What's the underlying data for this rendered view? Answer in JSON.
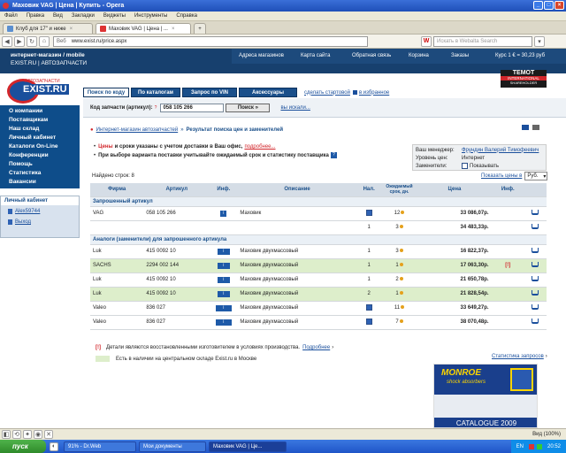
{
  "window": {
    "title": "Маховик VAG | Цена | Купить - Opera"
  },
  "menu": [
    "Файл",
    "Правка",
    "Вид",
    "Закладки",
    "Виджеты",
    "Инструменты",
    "Справка"
  ],
  "tabs": [
    {
      "label": "Клуб для 17\" и ниже"
    },
    {
      "label": "Маховик VAG | Цена | ..."
    }
  ],
  "address": {
    "prefix": "Веб",
    "url": "www.exist.ru/price.aspx",
    "search_placeholder": "Искать в Webalta Search"
  },
  "site": {
    "tagline1": "интернет-магазин / mobile",
    "tagline2": "EXIST.RU | АВТОЗАПЧАСТИ",
    "topnav": [
      "Адреса магазинов",
      "Карта сайта",
      "Обратная связь",
      "Корзина",
      "Заказы"
    ],
    "rate": "Курс 1 € = 30,23 руб",
    "logo_small": "АВТОЗАПЧАСТИ",
    "logo_text": "EXIST.RU",
    "temot_1": "TEMOT",
    "temot_2": "INTERNATIONAL",
    "temot_3": "SHAREHOLDER",
    "search_tabs": [
      "Поиск по коду",
      "По каталогам",
      "Запрос по VIN",
      "Аксессуары"
    ],
    "link_start": "сделать стартовой",
    "link_fav": "в избранное",
    "search_label": "Код запчасти (артикул):",
    "search_value": "058 105 266",
    "search_button": "Поиск »",
    "search_hint": "вы искали...",
    "sidebar": [
      "О компании",
      "Поставщикам",
      "Наш склад",
      "Личный кабинет",
      "Каталоги On-Line",
      "Конференции",
      "Помощь",
      "Статистика",
      "Вакансии"
    ],
    "cabinet_title": "Личный кабинет",
    "cabinet_user": "Alex59744",
    "cabinet_exit": "Выход",
    "breadcrumb_1": "Интернет-магазин автозапчастей",
    "breadcrumb_2": "Результат поиска цен и заменителей",
    "note1_a": "Цены",
    "note1_b": "и сроки указаны с учетом доставки в Ваш офис,",
    "note1_link": "подробнее...",
    "note2": "При выборе варианта поставки учитывайте ожидаемый срок и статистику поставщика",
    "manager_label": "Ваш менеджер:",
    "manager_value": "Фрундин Валерий Тимофеевич",
    "price_level_label": "Уровень цен:",
    "price_level_value": "Интернет",
    "substitutes_label": "Заменители:",
    "substitutes_value": "Показывать",
    "found": "Найдено строк: 8",
    "show_prices_in": "Показать цены в",
    "currency": "Руб.",
    "columns": [
      "Фирма",
      "Артикул",
      "Инф.",
      "Описание",
      "Нал.",
      "Ожидаемый срок, дн.",
      "Цена",
      "Инф.",
      ""
    ],
    "section_requested": "Запрошенный артикул",
    "section_analogs": "Аналоги (заменители) для запрошенного артикула",
    "rows_requested": [
      {
        "brand": "VAG",
        "article": "058 105 266",
        "desc": "Маховик",
        "qty": "",
        "days": "12",
        "price": "33 086,07р."
      },
      {
        "brand": "",
        "article": "",
        "desc": "",
        "qty": "1",
        "days": "3",
        "price": "34 483,33р."
      }
    ],
    "rows_analogs": [
      {
        "brand": "Luk",
        "article": "415 0092 10",
        "desc": "Маховик двухмассовый",
        "qty": "1",
        "days": "3",
        "price": "16 822,37р.",
        "flag": ""
      },
      {
        "brand": "SACHS",
        "article": "2294 002 144",
        "desc": "Маховик двухмассовый",
        "qty": "1",
        "days": "1",
        "price": "17 063,30р.",
        "flag": "[!]"
      },
      {
        "brand": "Luk",
        "article": "415 0092 10",
        "desc": "Маховик двухмассовый",
        "qty": "1",
        "days": "2",
        "price": "21 650,78р.",
        "flag": ""
      },
      {
        "brand": "Luk",
        "article": "415 0092 10",
        "desc": "Маховик двухмассовый",
        "qty": "2",
        "days": "1",
        "price": "21 828,54р.",
        "flag": ""
      },
      {
        "brand": "Valeo",
        "article": "836 027",
        "desc": "Маховик двухмассовый",
        "qty": "",
        "days": "11",
        "price": "33 649,27р.",
        "flag": ""
      },
      {
        "brand": "Valeo",
        "article": "836 027",
        "desc": "Маховик двухмассовый",
        "qty": "",
        "days": "7",
        "price": "38 070,48р.",
        "flag": ""
      }
    ],
    "legend1": "Детали являются восстановленными изготовителем в условиях производства.",
    "legend1_link": "Подробнее",
    "legend2": "Есть в наличии на центральном складе Exist.ru в Москве",
    "stats_link": "Статистика запросов",
    "ad_brand": "MONROE",
    "ad_sub": "shock absorbers",
    "ad_catalogue": "CATALOGUE 2009"
  },
  "status": {
    "zoom": "Вид (100%)"
  },
  "taskbar": {
    "start": "пуск",
    "items": [
      "91% - Dr.Web",
      "Мои документы",
      "Маховик VAG | Це..."
    ],
    "lang": "EN",
    "clock": "20:52"
  }
}
